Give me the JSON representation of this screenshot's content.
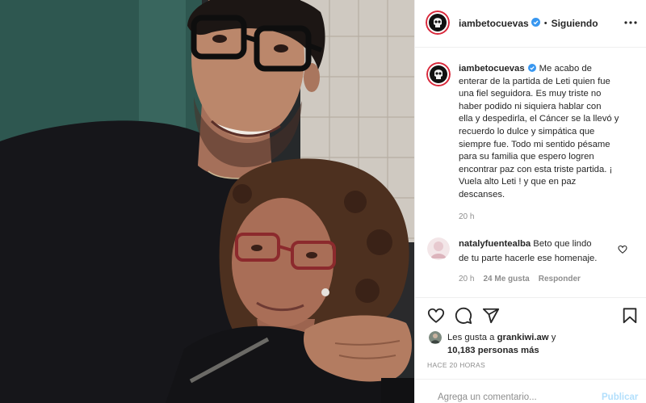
{
  "header": {
    "username": "iambetocuevas",
    "separator": "•",
    "follow_status": "Siguiendo",
    "more_icon": "ellipsis-icon",
    "verified_icon": "verified-badge-icon"
  },
  "caption": {
    "username": "iambetocuevas",
    "lines": [
      "Me acabo de",
      "enterar de la partida de Leti quien fue",
      "una fiel seguidora. Es muy triste no",
      "haber podido ni siquiera hablar con",
      "ella y despedirla, el Cáncer se la llevó y",
      "recuerdo lo dulce y simpática que",
      "siempre fue. Todo mi sentido pésame",
      "para su familia que espero logren",
      "encontrar paz con esta triste partida. ¡",
      "Vuela alto Leti ! y que en paz",
      "descanses."
    ],
    "time": "20 h"
  },
  "comments": [
    {
      "username": "natalyfuentealba",
      "lines": [
        "Beto que lindo",
        "de tu parte hacerle ese homenaje."
      ],
      "time": "20 h",
      "likes": "24 Me gusta",
      "reply": "Responder",
      "like_icon": "heart-outline-icon"
    }
  ],
  "actions": {
    "like_icon": "heart-icon",
    "comment_icon": "comment-bubble-icon",
    "share_icon": "paper-plane-icon",
    "save_icon": "bookmark-icon"
  },
  "likes": {
    "prefix": "Les gusta a",
    "user": "grankiwi.aw",
    "suffix": "y",
    "count": "10,183 personas más"
  },
  "timestamp": "HACE 20 HORAS",
  "comment_box": {
    "placeholder": "Agrega un comentario...",
    "submit": "Publicar"
  },
  "colors": {
    "text": "#262626",
    "muted": "#8e8e8e",
    "verified": "#3897f0",
    "publish_disabled": "#b2dffc",
    "divider": "#efefef",
    "avatar_ring": "#d8273a"
  }
}
